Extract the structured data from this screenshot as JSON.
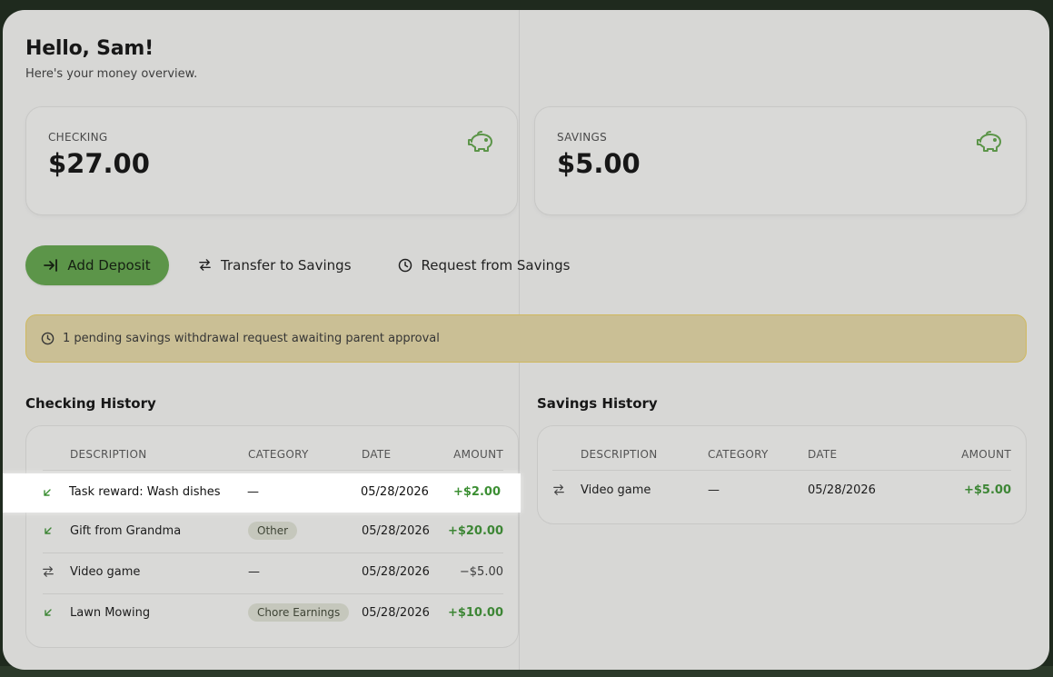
{
  "greeting": "Hello, Sam!",
  "subtitle": "Here's your money overview.",
  "accounts": [
    {
      "label": "CHECKING",
      "amount": "$27.00",
      "icon": "piggy-bank-icon"
    },
    {
      "label": "SAVINGS",
      "amount": "$5.00",
      "icon": "piggy-bank-icon"
    }
  ],
  "actions": {
    "deposit_label": "Add Deposit",
    "transfer_label": "Transfer to Savings",
    "request_label": "Request from Savings"
  },
  "pending_notice": "1 pending savings withdrawal request awaiting parent approval",
  "checking_history": {
    "title": "Checking History",
    "columns": [
      "DESCRIPTION",
      "CATEGORY",
      "DATE",
      "AMOUNT"
    ],
    "rows": [
      {
        "icon": "arrow-down-left-icon",
        "description": "Task reward: Wash dishes",
        "category": "—",
        "date": "05/28/2026",
        "amount": "+$2.00",
        "type": "credit"
      },
      {
        "icon": "arrow-down-left-icon",
        "description": "Gift from Grandma",
        "category": "Other",
        "date": "05/28/2026",
        "amount": "+$20.00",
        "type": "credit"
      },
      {
        "icon": "transfer-arrows-icon",
        "description": "Video game",
        "category": "—",
        "date": "05/28/2026",
        "amount": "−$5.00",
        "type": "debit"
      },
      {
        "icon": "arrow-down-left-icon",
        "description": "Lawn Mowing",
        "category": "Chore Earnings",
        "date": "05/28/2026",
        "amount": "+$10.00",
        "type": "credit"
      }
    ]
  },
  "savings_history": {
    "title": "Savings History",
    "columns": [
      "DESCRIPTION",
      "CATEGORY",
      "DATE",
      "AMOUNT"
    ],
    "rows": [
      {
        "icon": "transfer-arrows-icon",
        "description": "Video game",
        "category": "—",
        "date": "05/28/2026",
        "amount": "+$5.00",
        "type": "credit"
      }
    ]
  },
  "colors": {
    "accent_green": "#5fa049",
    "positive_amount": "#3c8f33",
    "pending_border": "#e2c861"
  }
}
